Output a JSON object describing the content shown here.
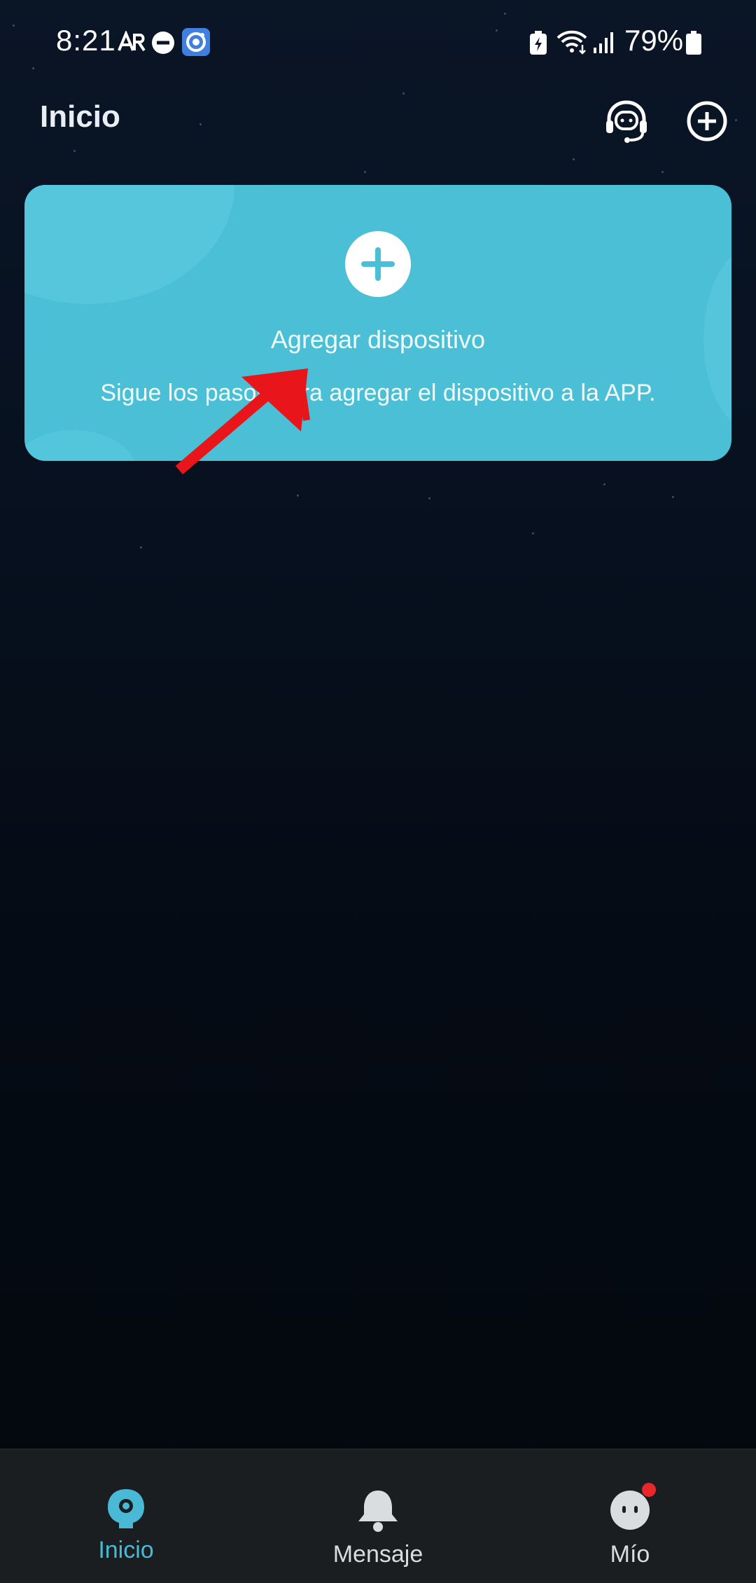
{
  "status_bar": {
    "time": "8:21",
    "battery_percent": "79%",
    "icons": [
      "ar-icon",
      "dnd-icon",
      "app-notification-icon",
      "battery-saver-icon",
      "wifi-icon",
      "signal-icon",
      "battery-icon"
    ]
  },
  "header": {
    "title": "Inicio",
    "support_icon": "headset-icon",
    "add_icon": "plus-circle-icon"
  },
  "add_device_card": {
    "title": "Agregar dispositivo",
    "subtitle": "Sigue los pasos para agregar el dispositivo a la APP.",
    "icon": "plus-icon",
    "accent_color": "#4bbfd5"
  },
  "annotation": {
    "color": "#e8161b",
    "icon": "red-arrow-icon"
  },
  "bottom_nav": {
    "items": [
      {
        "label": "Inicio",
        "icon": "home-camera-icon",
        "active": true
      },
      {
        "label": "Mensaje",
        "icon": "bell-icon",
        "active": false
      },
      {
        "label": "Mío",
        "icon": "profile-face-icon",
        "active": false,
        "badge": true
      }
    ],
    "active_color": "#49b9d6",
    "inactive_color": "#dadde0"
  }
}
